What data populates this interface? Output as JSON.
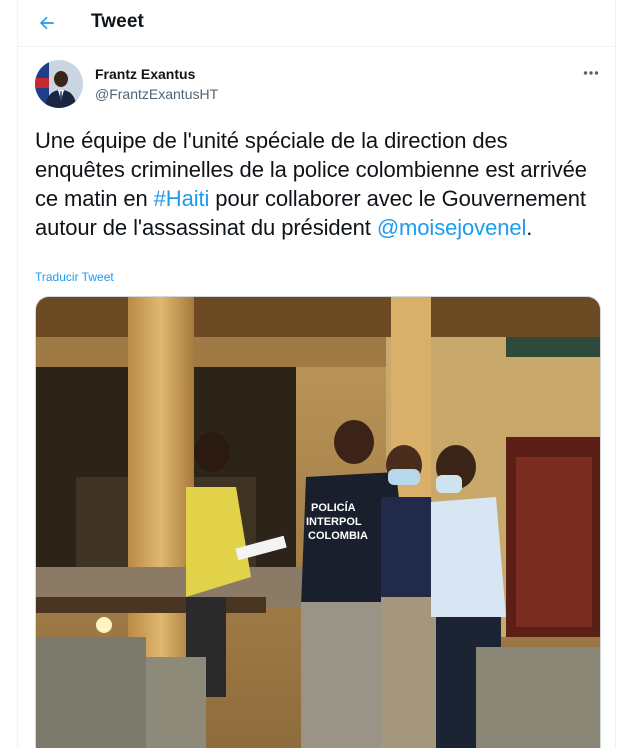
{
  "header": {
    "title": "Tweet",
    "back_icon": "arrow-left-icon"
  },
  "tweet": {
    "author": {
      "name": "Frantz Exantus",
      "handle": "@FrantzExantusHT"
    },
    "more_icon": "more-horizontal-icon",
    "text": {
      "part1": "Une équipe de l'unité spéciale de la direction des enquêtes criminelles de la police colombienne est arrivée ce matin en ",
      "hashtag": "#Haiti",
      "part2": " pour collaborer avec le Gouvernement autour de l'assassinat du président ",
      "mention": "@moisejovenel",
      "part3": "."
    },
    "translate_label": "Traducir Tweet",
    "photo": {
      "vest_text": [
        "POLICÍA",
        "INTERPOL",
        "COLOMBIA"
      ]
    }
  },
  "colors": {
    "accent": "#1d9bf0",
    "text": "#0f1419",
    "secondary": "#536471",
    "border": "#eff3f4"
  }
}
